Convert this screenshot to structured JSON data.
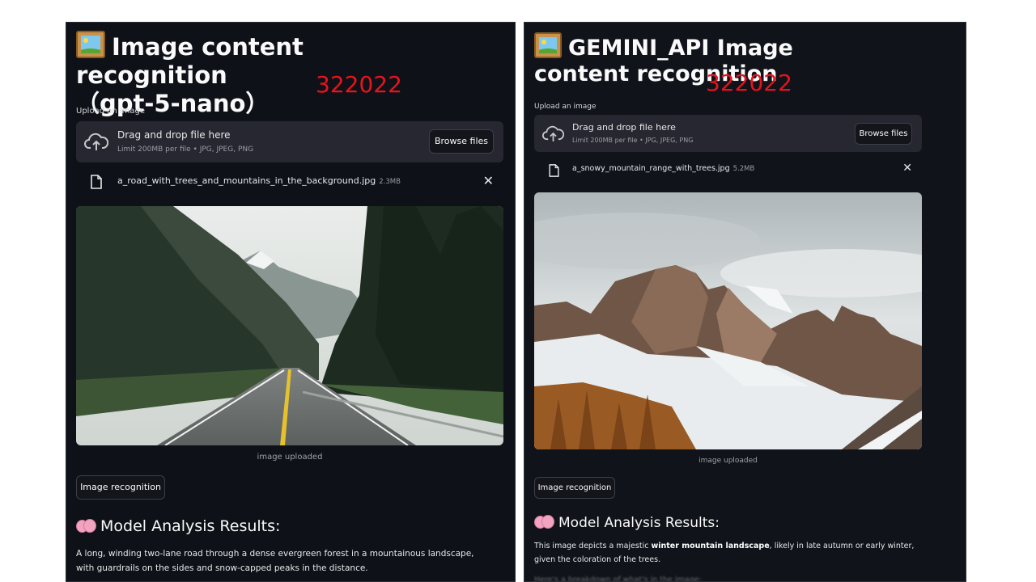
{
  "left_panel": {
    "title": "Image content recognition",
    "title_line2": "（gpt-5-nano）",
    "overlay_number": "322022",
    "upload_label": "Upload an image",
    "dropzone_title": "Drag and drop file here",
    "dropzone_limit": "Limit 200MB per file • JPG, JPEG, PNG",
    "browse_label": "Browse files",
    "file_name": "a_road_with_trees_and_mountains_in_the_background.jpg",
    "file_size": "2.3MB",
    "image_caption": "image uploaded",
    "recognize_label": "Image recognition",
    "results_heading": "Model Analysis Results:",
    "result_text": "A long, winding two-lane road through a dense evergreen forest in a mountainous landscape, with guardrails on the sides and snow-capped peaks in the distance."
  },
  "right_panel": {
    "title": "GEMINI_API Image content recognition",
    "overlay_number": "322022",
    "upload_label": "Upload an image",
    "dropzone_title": "Drag and drop file here",
    "dropzone_limit": "Limit 200MB per file • JPG, JPEG, PNG",
    "browse_label": "Browse files",
    "file_name": "a_snowy_mountain_range_with_trees.jpg",
    "file_size": "5.2MB",
    "image_caption": "image uploaded",
    "recognize_label": "Image recognition",
    "results_heading": "Model Analysis Results:",
    "result_part1": "This image depicts a majestic ",
    "result_bold1": "winter mountain landscape",
    "result_part2": ", likely in late autumn or early winter, given the coloration of the trees.",
    "result_faded": "Here's a breakdown of what's in the image:"
  },
  "icons": [
    "framed-picture-icon",
    "cloud-upload-icon",
    "file-icon",
    "close-icon",
    "brain-icon"
  ],
  "colors": {
    "background": "#0e1117",
    "widget": "#262730",
    "overlay_red": "#e8131c",
    "text": "#fafafa"
  }
}
